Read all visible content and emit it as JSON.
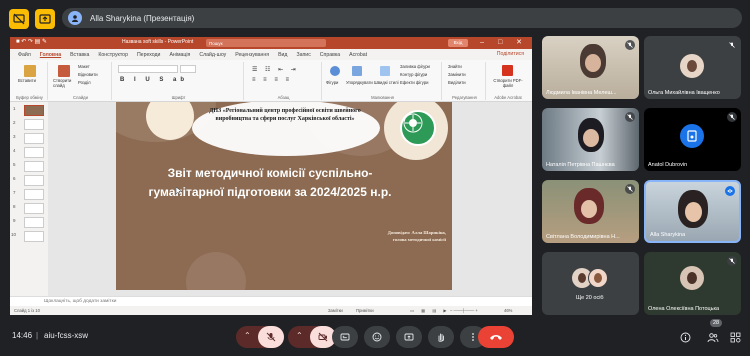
{
  "meet": {
    "presenter_label": "Alla Sharykina (Презентація)",
    "time": "14:46",
    "separator": "|",
    "meeting_code": "aiu-fcss-xsw",
    "participants_badge": "28"
  },
  "powerpoint": {
    "window_title": "Названа soft skills  -  PowerPoint",
    "search_placeholder": "Пошук",
    "signin_label": "Вхід",
    "share_label": "Поділитися",
    "menu_tabs": [
      "Файл",
      "Головна",
      "Вставка",
      "Конструктор",
      "Переходи",
      "Анімація",
      "Слайд-шоу",
      "Рецензування",
      "Вид",
      "Запис",
      "Справка",
      "Acrobat"
    ],
    "active_tab": "Головна",
    "ribbon": {
      "clipboard_group": "Буфер обміну",
      "paste": "Вставити",
      "slides_group": "Слайди",
      "new_slide": "Створити слайд",
      "layout": "Макет",
      "reset": "Відновити",
      "section": "Розділ",
      "font_group": "Шрифт",
      "paragraph_group": "Абзац",
      "drawing_group": "Малювання",
      "shapes": "Фігури",
      "arrange": "Упорядкувати",
      "quick_styles": "Швидкі стилі",
      "shape_fill": "Заливка фігури",
      "shape_outline": "Контур фігури",
      "shape_effects": "Ефекти фігури",
      "editing_group": "Редагування",
      "find": "Знайти",
      "replace": "Замінити",
      "select": "Виділити",
      "acrobat_group": "Adobe Acrobat",
      "create_pdf": "Створити PDF-файл"
    },
    "slide_numbers": [
      "1",
      "2",
      "3",
      "4",
      "5",
      "6",
      "7",
      "8",
      "9",
      "10"
    ],
    "slide": {
      "org": "ДНЗ «Регіональний центр професійної освіти швейного виробництва та сфери послуг Харківської області»",
      "title": "Звіт методичної комісії суспільно-гуманітарної підготовки за 2024/2025 н.р.",
      "reporter_line1": "Доповідач: Алла Шарикіна,",
      "reporter_line2": "голова методичної комісії"
    },
    "notes_placeholder": "Щоклацніть, щоб додати замітки",
    "status_slide": "Слайд 1 із 10",
    "status_notes": "Замітки",
    "status_comments": "Примітки",
    "zoom": "46%"
  },
  "participants": [
    {
      "name": "Людмила Іванівна Мелеш..."
    },
    {
      "name": "Ольга Михайлівна Іващенко"
    },
    {
      "name": "Наталія Петрівна Пашнєва"
    },
    {
      "name": "Anatol Dubrovin"
    },
    {
      "name": "Світлана Володимирівна Н..."
    },
    {
      "name": "Alla Sharykina"
    },
    {
      "name": "Ще 20 осіб"
    },
    {
      "name": "Олена Олексіївна Потоцька"
    }
  ],
  "colors": {
    "meet_bg": "#202124",
    "ppt_accent": "#b7472a",
    "slide_bg": "#8c6b52",
    "end_call": "#ea4335",
    "presenting_yellow": "#fbbc04"
  }
}
